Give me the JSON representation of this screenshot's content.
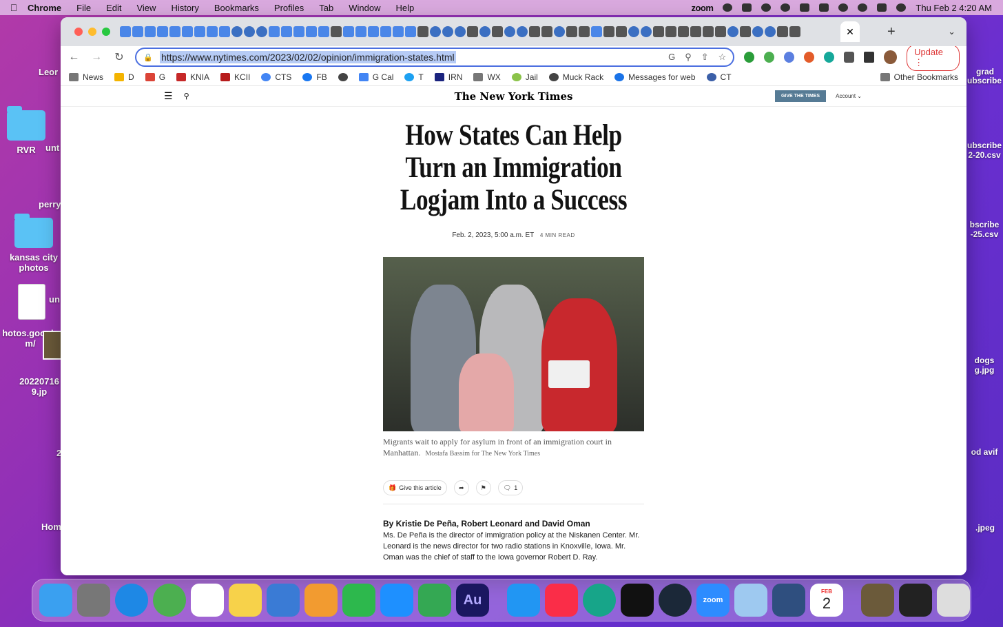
{
  "menubar": {
    "app": "Chrome",
    "items": [
      "File",
      "Edit",
      "View",
      "History",
      "Bookmarks",
      "Profiles",
      "Tab",
      "Window",
      "Help"
    ],
    "zoom": "zoom",
    "clock": "Thu Feb 2  4:20 AM"
  },
  "desktop": {
    "left": [
      "Leor",
      "RVR",
      "unt",
      "perry",
      "kansas city photos",
      "un",
      "hotos.google m/",
      "20220716 9.jp",
      "2",
      "Hom"
    ],
    "right": [
      "grad",
      "ubscribe",
      "ubscribe 2-20.csv",
      "bscribe -25.csv",
      "dogs g.jpg",
      "od avif",
      ".jpeg"
    ]
  },
  "browser": {
    "url": "https://www.nytimes.com/2023/02/02/opinion/immigration-states.html",
    "update_label": "Update",
    "active_tab_close": "✕",
    "bookmarks": [
      "News",
      "D",
      "G",
      "KNIA",
      "KCII",
      "CTS",
      "FB",
      "",
      "G Cal",
      "T",
      "IRN",
      "WX",
      "Jail",
      "Muck Rack",
      "Messages for web",
      "CT"
    ],
    "other_bookmarks": "Other Bookmarks"
  },
  "nyt": {
    "logo": "The New York Times",
    "give_times": "GIVE THE TIMES",
    "account": "Account"
  },
  "article": {
    "headline": "How States Can Help Turn an Immigration Logjam Into a Success",
    "date": "Feb. 2, 2023, 5:00 a.m. ET",
    "read_time": "4 MIN READ",
    "caption": "Migrants wait to apply for asylum in front of an immigration court in Manhattan.",
    "credit": "Mostafa Bassim for The New York Times",
    "give_article": "Give this article",
    "comments": "1",
    "byline": "By Kristie De Peña, Robert Leonard and David Oman",
    "bio": "Ms. De Peña is the director of immigration policy at the Niskanen Center. Mr. Leonard is the news director for two radio stations in Knoxville, Iowa. Mr. Oman was the chief of staff to the Iowa governor Robert D. Ray."
  },
  "dock": {
    "calendar_month": "FEB",
    "calendar_day": "2",
    "audition": "Au",
    "zoom": "zoom"
  },
  "colors": {
    "accent": "#4a6ee0",
    "give_times_bg": "#567b95",
    "update": "#dd3333"
  }
}
